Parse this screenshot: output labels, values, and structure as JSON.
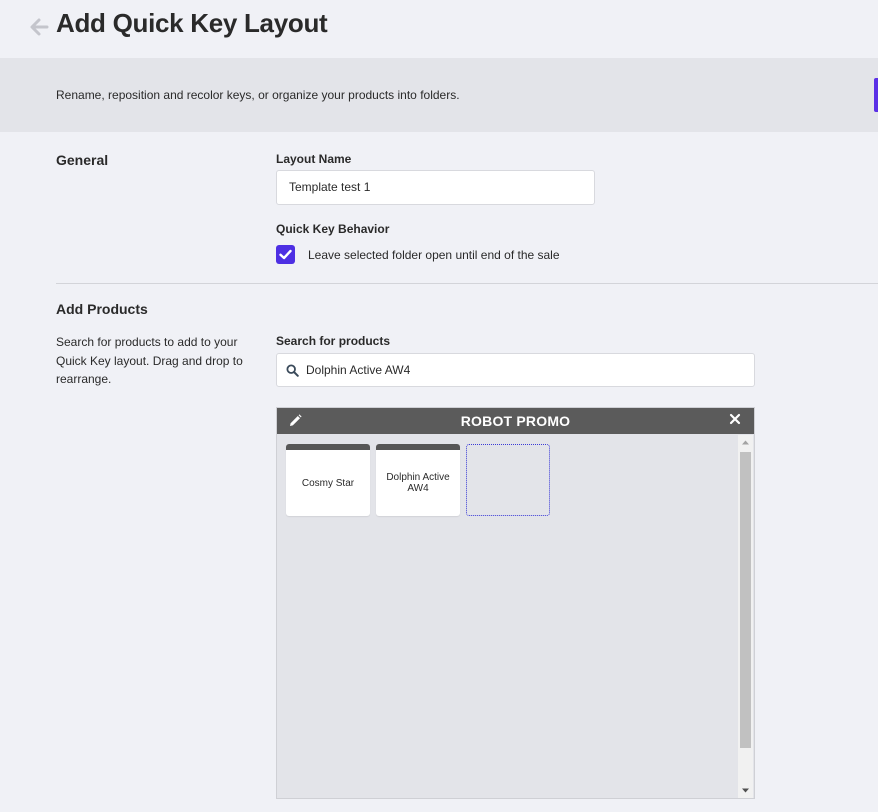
{
  "header": {
    "title": "Add Quick Key Layout",
    "back_icon": "arrow-left-icon"
  },
  "banner": {
    "text": "Rename, reposition and recolor keys, or organize your products into folders.",
    "accent_color": "#5b30e6"
  },
  "general": {
    "heading": "General",
    "layout_name_label": "Layout Name",
    "layout_name_value": "Template test 1",
    "behavior_label": "Quick Key Behavior",
    "checkbox_label": "Leave selected folder open until end of the sale",
    "checkbox_checked": true,
    "checkbox_color": "#4d2fe3"
  },
  "add_products": {
    "heading": "Add Products",
    "description": "Search for products to add to your Quick Key layout. Drag and drop to rearrange.",
    "search_label": "Search for products",
    "search_value": "Dolphin Active AW4",
    "search_icon": "search-icon"
  },
  "folder": {
    "title": "ROBOT PROMO",
    "edit_icon": "pencil-icon",
    "close_icon": "close-icon",
    "header_color": "#5b5b5b",
    "keys": [
      {
        "label": "Cosmy Star"
      },
      {
        "label": "Dolphin Active AW4"
      }
    ]
  }
}
